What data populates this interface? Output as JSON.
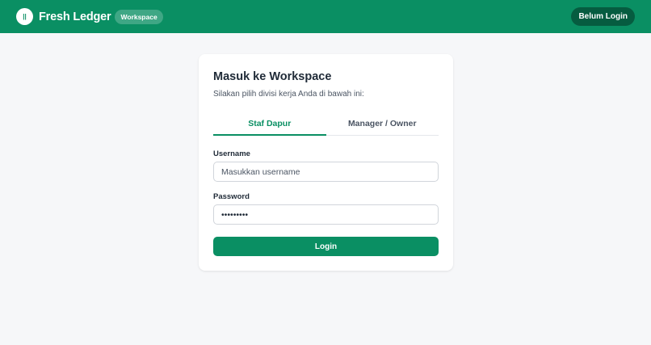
{
  "header": {
    "logo_glyph": "||",
    "brand": "Fresh Ledger",
    "badge": "Workspace",
    "status": "Belum Login"
  },
  "login_card": {
    "title": "Masuk ke Workspace",
    "subtitle": "Silakan pilih divisi kerja Anda di bawah ini:",
    "tabs": [
      {
        "label": "Staf Dapur",
        "active": true
      },
      {
        "label": "Manager / Owner",
        "active": false
      }
    ],
    "username": {
      "label": "Username",
      "placeholder": "Masukkan username",
      "value": ""
    },
    "password": {
      "label": "Password",
      "value": "password1"
    },
    "submit_label": "Login"
  },
  "colors": {
    "brand": "#0a8f63",
    "brand_dark": "#065c40",
    "background": "#f6f7f9"
  }
}
